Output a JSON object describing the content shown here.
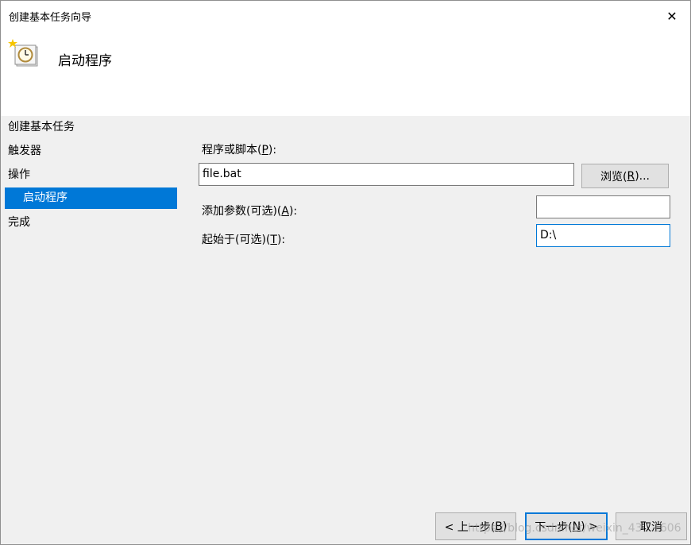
{
  "window": {
    "title": "创建基本任务向导",
    "close_glyph": "✕"
  },
  "header": {
    "title": "启动程序",
    "icon": "clock-task-icon"
  },
  "nav": {
    "items": [
      {
        "label": "创建基本任务",
        "selected": false
      },
      {
        "label": "触发器",
        "selected": false
      },
      {
        "label": "操作",
        "selected": false
      },
      {
        "label": "启动程序",
        "selected": true
      },
      {
        "label": "完成",
        "selected": false
      }
    ]
  },
  "form": {
    "program": {
      "label_pre": "程序或脚本(",
      "label_key": "P",
      "label_post": "):",
      "value": "file.bat"
    },
    "browse_button": {
      "pre": "浏览(",
      "key": "R",
      "post": ")..."
    },
    "args": {
      "label_pre": "添加参数(可选)(",
      "label_key": "A",
      "label_post": "):",
      "value": ""
    },
    "start_in": {
      "label_pre": "起始于(可选)(",
      "label_key": "T",
      "label_post": "):",
      "value": "D:\\"
    }
  },
  "footer": {
    "back": {
      "pre": "< 上一步(",
      "key": "B",
      "post": ")"
    },
    "next": {
      "pre": "下一步(",
      "key": "N",
      "post": ") >"
    },
    "cancel": {
      "label": "取消"
    }
  },
  "watermark": "https://blog.csdn.net/weixin_43...1606"
}
